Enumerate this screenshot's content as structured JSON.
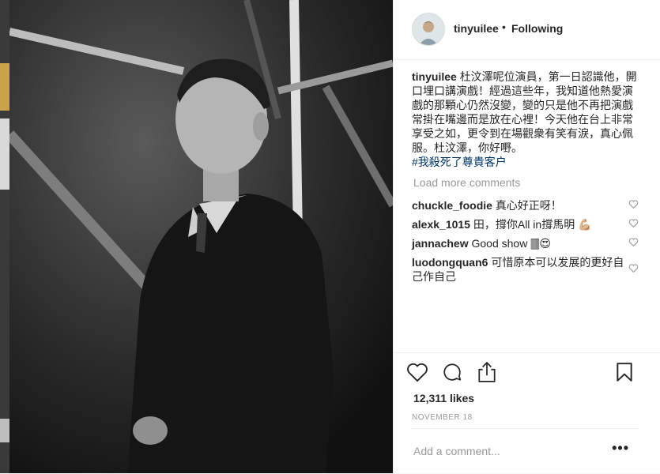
{
  "post": {
    "author": "tinyuilee",
    "separator": "•",
    "follow_status": "Following",
    "caption_user": "tinyuilee",
    "caption_text": "杜汶澤呢位演員，第一日認識他，開口埋口講演戲！經過這些年，我知道他熱愛演戲的那顆心仍然沒變，變的只是他不再把演戲常掛在嘴邊而是放在心裡！今天他在台上非常享受之如，更令到在場觀衆有笑有淚，真心佩服。杜汶澤，你好嘢。",
    "hashtag": "#我殺死了尊貴客户",
    "load_more": "Load more comments",
    "likes": "12,311 likes",
    "date": "NOVEMBER 18",
    "add_comment_placeholder": "Add a comment...",
    "more_label": "•••"
  },
  "comments": [
    {
      "user": "chuckle_foodie",
      "text": "真心好正呀！"
    },
    {
      "user": "alexk_1015",
      "text": "田，撐你All in撐馬明 💪🏼"
    },
    {
      "user": "jannachew",
      "text": "Good show 🀫😍"
    },
    {
      "user": "luodongquan6",
      "text": "可惜原本可以发展的更好自己作自己"
    }
  ],
  "icons": {
    "like": "heart-icon",
    "comment": "comment-bubble-icon",
    "share": "share-upload-icon",
    "save": "bookmark-icon",
    "comment_like": "small-heart-icon"
  }
}
